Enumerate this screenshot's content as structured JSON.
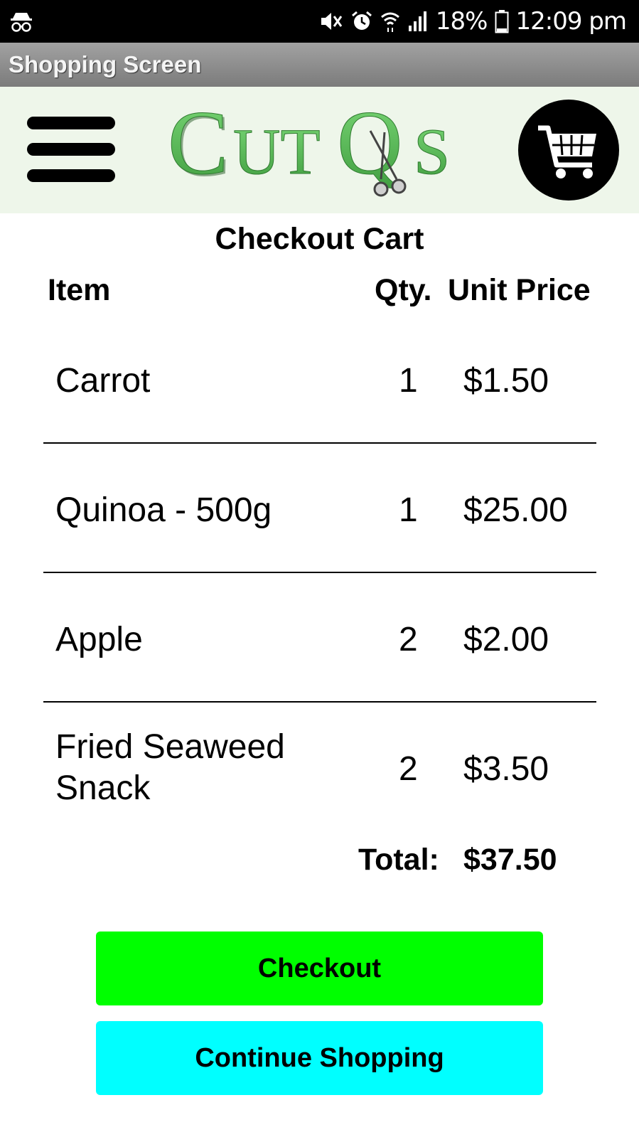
{
  "status_bar": {
    "battery": "18%",
    "time": "12:09 pm",
    "icons": [
      "incognito-icon",
      "mute-icon",
      "alarm-icon",
      "wifi-icon",
      "signal-icon",
      "battery-icon"
    ]
  },
  "app_bar": {
    "title": "Shopping Screen"
  },
  "header": {
    "logo_text": "CutQs",
    "menu_icon": "hamburger-menu-icon",
    "cart_icon": "shopping-cart-icon"
  },
  "cart": {
    "title": "Checkout Cart",
    "columns": {
      "item": "Item",
      "qty": "Qty.",
      "unit_price": "Unit Price"
    },
    "items": [
      {
        "name": "Carrot",
        "qty": "1",
        "price": "$1.50"
      },
      {
        "name": "Quinoa - 500g",
        "qty": "1",
        "price": "$25.00"
      },
      {
        "name": "Apple",
        "qty": "2",
        "price": "$2.00"
      },
      {
        "name_line1": "Fried Seaweed",
        "name_line2": "Snack",
        "qty": "2",
        "price": "$3.50"
      }
    ],
    "total_label": "Total:",
    "total_value": "$37.50"
  },
  "actions": {
    "checkout_label": "Checkout",
    "continue_label": "Continue Shopping"
  },
  "colors": {
    "status_bar": "#000000",
    "header_bg": "#eef6ea",
    "logo_green": "#5cbf5a",
    "checkout_button": "#00ff00",
    "continue_button": "#00ffff"
  }
}
